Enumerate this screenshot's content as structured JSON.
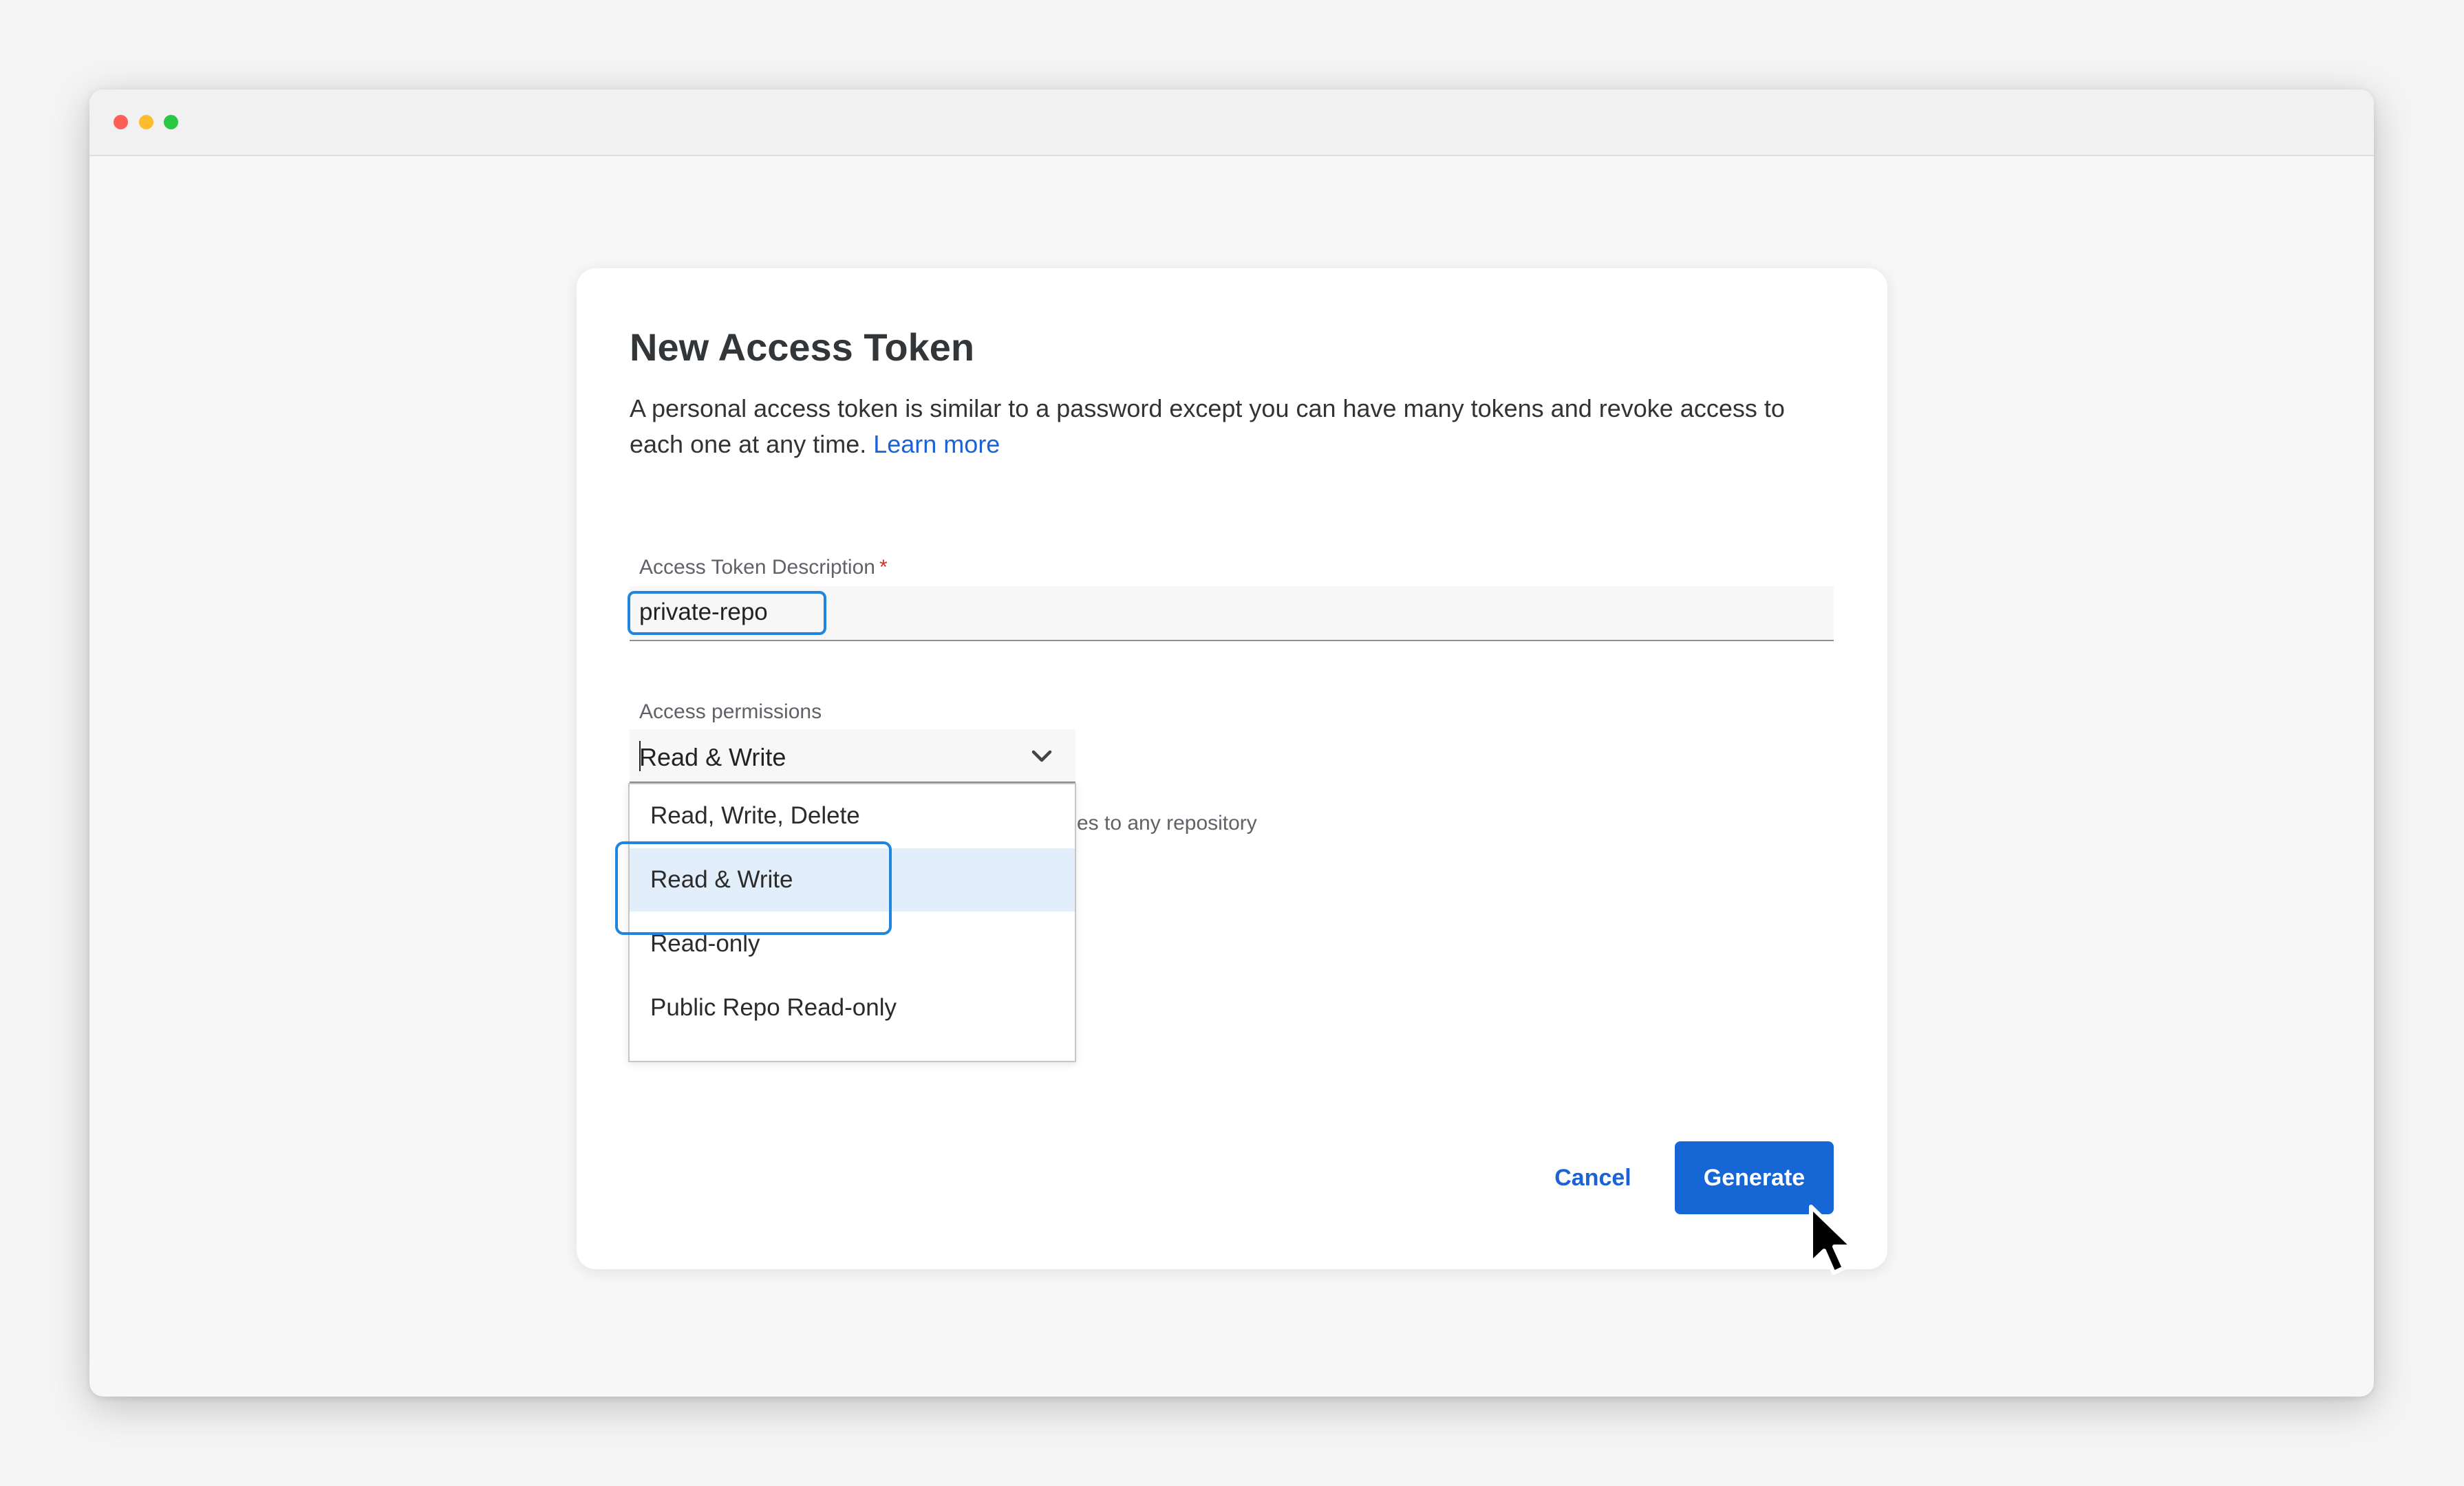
{
  "window": {
    "controls": [
      "close",
      "minimize",
      "zoom"
    ]
  },
  "dialog": {
    "title": "New Access Token",
    "description": "A personal access token is similar to a password except you can have many tokens and revoke access to each one at any time.",
    "learn_more": "Learn more"
  },
  "description_field": {
    "label": "Access Token Description",
    "required_mark": "*",
    "value": "private-repo"
  },
  "permissions_field": {
    "label": "Access permissions",
    "selected": "Read & Write",
    "helper_text": "es to any repository",
    "options": [
      "Read, Write, Delete",
      "Read & Write",
      "Read-only",
      "Public Repo Read-only"
    ],
    "highlighted_option": "Read & Write"
  },
  "actions": {
    "cancel": "Cancel",
    "generate": "Generate"
  },
  "colors": {
    "accent": "#1766d6",
    "link": "#1a62d6",
    "highlight_outline": "#1f86e0",
    "selected_option_bg": "#e3eefb",
    "required": "#d93025"
  },
  "icons": {
    "select": "chevron-down-icon",
    "pointer": "mouse-pointer-icon"
  }
}
